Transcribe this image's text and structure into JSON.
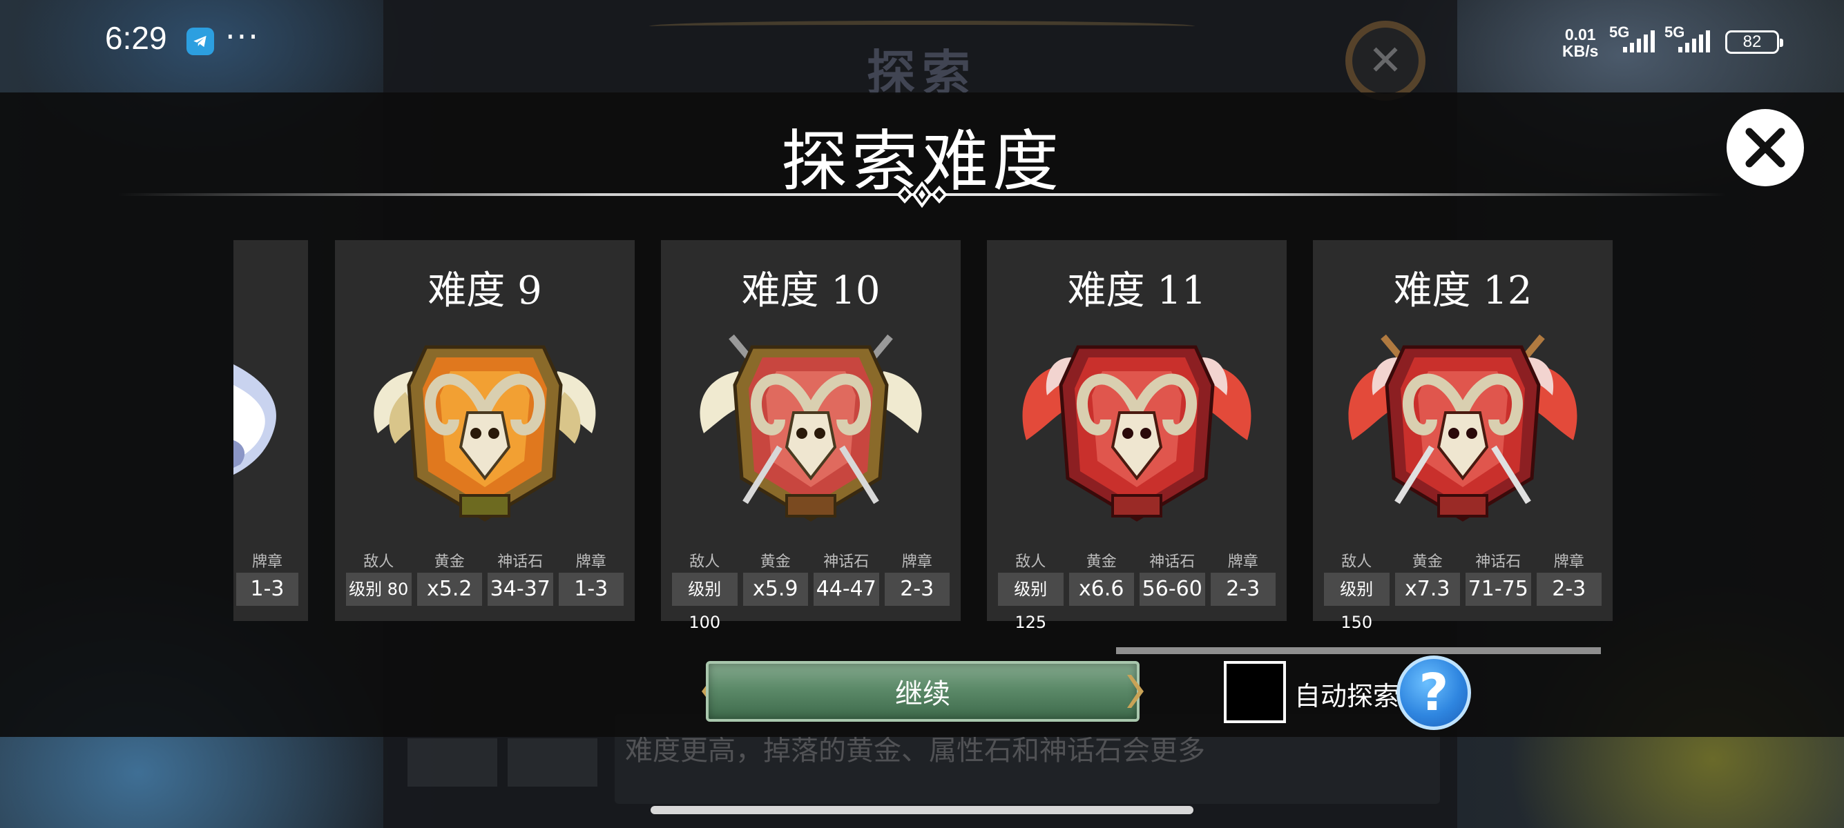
{
  "status_bar": {
    "time": "6:29",
    "dots": "···",
    "net_speed_value": "0.01",
    "net_speed_unit": "KB/s",
    "signal1_label": "5G",
    "signal2_label": "5G",
    "battery": "82"
  },
  "background": {
    "explore_title": "探索",
    "description": "难度更高，掉落的黄金、属性石和神话石会更多"
  },
  "dialog": {
    "title": "探索难度"
  },
  "partial_card": {
    "stat_label": "牌章",
    "stat_value": "1-3"
  },
  "cards": [
    {
      "title": "难度 9",
      "emblem_theme": "bronze-orange",
      "stats": [
        {
          "label": "敌人",
          "value": "级别 80"
        },
        {
          "label": "黄金",
          "value": "x5.2"
        },
        {
          "label": "神话石",
          "value": "34-37"
        },
        {
          "label": "牌章",
          "value": "1-3"
        }
      ]
    },
    {
      "title": "难度 10",
      "emblem_theme": "bronze-red-swords",
      "stats": [
        {
          "label": "敌人",
          "value": "级别 100"
        },
        {
          "label": "黄金",
          "value": "x5.9"
        },
        {
          "label": "神话石",
          "value": "44-47"
        },
        {
          "label": "牌章",
          "value": "2-3"
        }
      ]
    },
    {
      "title": "难度 11",
      "emblem_theme": "red",
      "stats": [
        {
          "label": "敌人",
          "value": "级别 125"
        },
        {
          "label": "黄金",
          "value": "x6.6"
        },
        {
          "label": "神话石",
          "value": "56-60"
        },
        {
          "label": "牌章",
          "value": "2-3"
        }
      ]
    },
    {
      "title": "难度 12",
      "emblem_theme": "red-swords",
      "stats": [
        {
          "label": "敌人",
          "value": "级别 150"
        },
        {
          "label": "黄金",
          "value": "x7.3"
        },
        {
          "label": "神话石",
          "value": "71-75"
        },
        {
          "label": "牌章",
          "value": "2-3"
        }
      ]
    }
  ],
  "controls": {
    "continue_label": "继续",
    "auto_explore_label": "自动探索",
    "auto_explore_checked": false,
    "help_symbol": "?"
  },
  "colors": {
    "overlay": "#0c0c0c",
    "card_bg": "#2c2c2c",
    "stat_bg": "#4a4a4a",
    "continue_green": "#5c8a69",
    "help_blue": "#2f86e0"
  }
}
